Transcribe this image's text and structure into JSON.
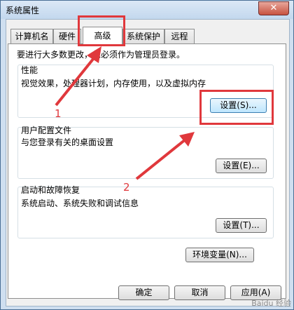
{
  "window": {
    "title": "系统属性",
    "close_glyph": "✕"
  },
  "tabs": [
    {
      "label": "计算机名"
    },
    {
      "label": "硬件"
    },
    {
      "label": "高级",
      "active": true
    },
    {
      "label": "系统保护"
    },
    {
      "label": "远程"
    }
  ],
  "admin_note": "要进行大多数更改，您必须作为管理员登录。",
  "performance": {
    "label": "性能",
    "description": "视觉效果，处理器计划，内存使用，以及虚拟内存",
    "button": "设置(S)..."
  },
  "user_profiles": {
    "label": "用户配置文件",
    "description": "与您登录有关的桌面设置",
    "button": "设置(E)..."
  },
  "startup_recovery": {
    "label": "启动和故障恢复",
    "description": "系统启动、系统失败和调试信息",
    "button": "设置(T)..."
  },
  "env_button": "环境变量(N)...",
  "footer": {
    "ok": "确定",
    "cancel": "取消",
    "apply": "应用(A)"
  },
  "annotations": {
    "step1": "1",
    "step2": "2",
    "color": "#e0383c"
  },
  "watermark": "Baidu 经验"
}
